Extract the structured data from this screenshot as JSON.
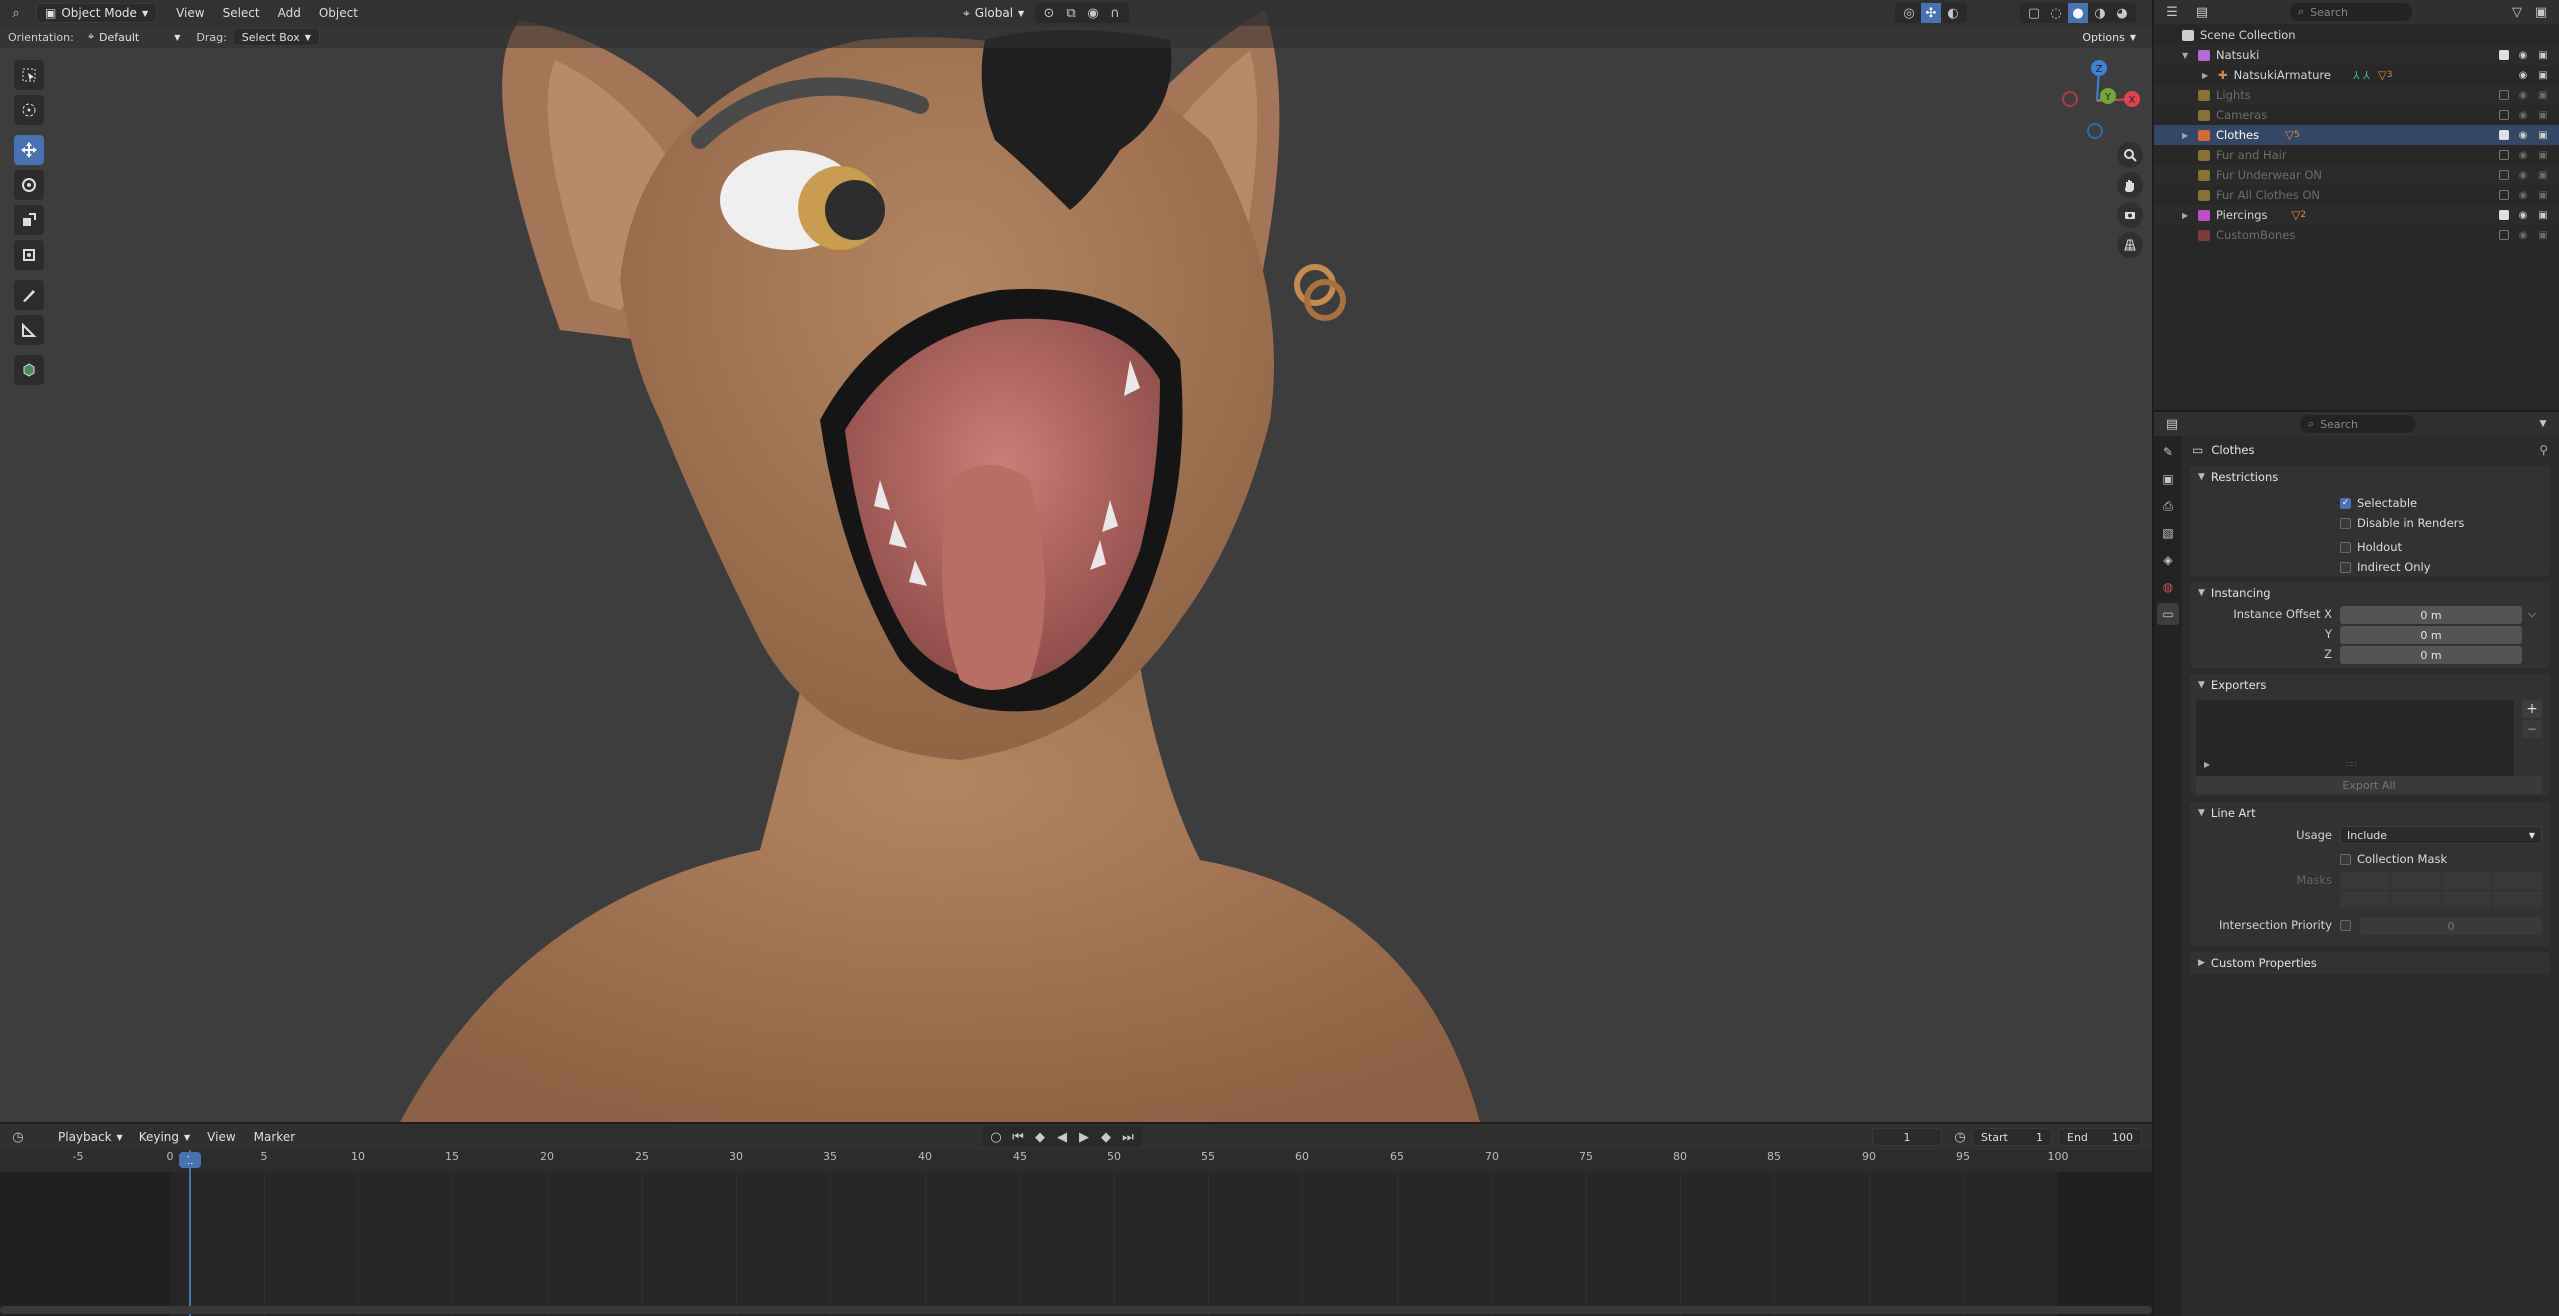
{
  "viewport": {
    "header": {
      "mode_label": "Object Mode",
      "menus": [
        "View",
        "Select",
        "Add",
        "Object"
      ],
      "transform_orientation": "Global",
      "options_label": "Options"
    },
    "tool_settings": {
      "orientation_label": "Orientation:",
      "orientation_value": "Default",
      "drag_label": "Drag:",
      "drag_value": "Select Box"
    },
    "gizmo_axes": [
      "X",
      "Y",
      "Z"
    ],
    "toolbar_icons": [
      "select-box-icon",
      "cursor-icon",
      "move-icon",
      "rotate-icon",
      "scale-icon",
      "transform-icon",
      "annotate-icon",
      "measure-icon",
      "add-cube-icon"
    ],
    "nav_icons": [
      "zoom-icon",
      "pan-icon",
      "camera-view-icon",
      "ortho-grid-icon"
    ]
  },
  "timeline": {
    "menus": [
      "Playback",
      "Keying",
      "View",
      "Marker"
    ],
    "current_frame": "1",
    "start_label": "Start",
    "start_value": "1",
    "end_label": "End",
    "end_value": "100",
    "ruler_ticks": [
      "-5",
      "0",
      "5",
      "10",
      "15",
      "20",
      "25",
      "30",
      "35",
      "40",
      "45",
      "50",
      "55",
      "60",
      "65",
      "70",
      "75",
      "80",
      "85",
      "90",
      "95",
      "100"
    ],
    "playhead_label": "1"
  },
  "outliner": {
    "search_placeholder": "Search",
    "rows": [
      {
        "label": "Scene Collection",
        "color": "#cfcfcf"
      },
      {
        "label": "Natsuki",
        "color": "#b36ad6"
      },
      {
        "label": "NatsukiArmature",
        "color": "#d18a4a",
        "extra": "3"
      },
      {
        "label": "Lights",
        "color": "#c9a23a"
      },
      {
        "label": "Cameras",
        "color": "#c9a23a"
      },
      {
        "label": "Clothes",
        "color": "#d46a2f",
        "extra": "5"
      },
      {
        "label": "Fur and Hair",
        "color": "#c9a23a"
      },
      {
        "label": "Fur Underwear ON",
        "color": "#c9a23a"
      },
      {
        "label": "Fur All Clothes ON",
        "color": "#c9a23a"
      },
      {
        "label": "Piercings",
        "color": "#c04fc7",
        "extra": "2"
      },
      {
        "label": "CustomBones",
        "color": "#b54a4a"
      }
    ]
  },
  "properties": {
    "search_placeholder": "Search",
    "collection_name": "Clothes",
    "restrictions": {
      "title": "Restrictions",
      "selectable": "Selectable",
      "disable_in_renders": "Disable in Renders",
      "holdout": "Holdout",
      "indirect_only": "Indirect Only"
    },
    "instancing": {
      "title": "Instancing",
      "offset_x_label": "Instance Offset X",
      "offset_y_label": "Y",
      "offset_z_label": "Z",
      "offset_x": "0 m",
      "offset_y": "0 m",
      "offset_z": "0 m"
    },
    "exporters": {
      "title": "Exporters",
      "export_all": "Export All"
    },
    "line_art": {
      "title": "Line Art",
      "usage_label": "Usage",
      "usage_value": "Include",
      "collection_mask": "Collection Mask",
      "masks_label": "Masks",
      "intersection_priority_label": "Intersection Priority",
      "intersection_priority_value": "0"
    },
    "custom_properties": {
      "title": "Custom Properties"
    }
  },
  "colors": {
    "accent": "#4772b3",
    "skin": "#a87858",
    "axis_x": "#e0434e",
    "axis_y": "#72a83a",
    "axis_z": "#3b83d6"
  }
}
